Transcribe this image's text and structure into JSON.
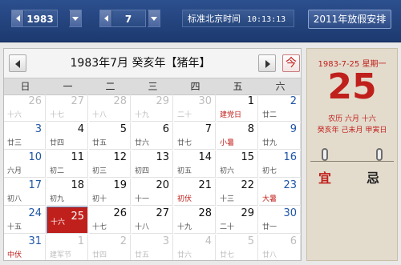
{
  "toolbar": {
    "year": "1983",
    "month": "7",
    "clock_label": "标准北京时间",
    "clock_time": "10:13:13",
    "holiday_button": "2011年放假安排"
  },
  "calendar": {
    "title": "1983年7月  癸亥年【猪年】",
    "today_label": "今",
    "weekdays": [
      "日",
      "一",
      "二",
      "三",
      "四",
      "五",
      "六"
    ],
    "weeks": [
      [
        {
          "day": "26",
          "lunar": "十六",
          "other": true
        },
        {
          "day": "27",
          "lunar": "十七",
          "other": true
        },
        {
          "day": "28",
          "lunar": "十八",
          "other": true
        },
        {
          "day": "29",
          "lunar": "十九",
          "other": true
        },
        {
          "day": "30",
          "lunar": "二十",
          "other": true
        },
        {
          "day": "1",
          "lunar": "建党日",
          "red": true
        },
        {
          "day": "2",
          "lunar": "廿二"
        }
      ],
      [
        {
          "day": "3",
          "lunar": "廿三"
        },
        {
          "day": "4",
          "lunar": "廿四"
        },
        {
          "day": "5",
          "lunar": "廿五"
        },
        {
          "day": "6",
          "lunar": "廿六"
        },
        {
          "day": "7",
          "lunar": "廿七"
        },
        {
          "day": "8",
          "lunar": "小暑",
          "red": true
        },
        {
          "day": "9",
          "lunar": "廿九"
        }
      ],
      [
        {
          "day": "10",
          "lunar": "六月"
        },
        {
          "day": "11",
          "lunar": "初二"
        },
        {
          "day": "12",
          "lunar": "初三"
        },
        {
          "day": "13",
          "lunar": "初四"
        },
        {
          "day": "14",
          "lunar": "初五"
        },
        {
          "day": "15",
          "lunar": "初六"
        },
        {
          "day": "16",
          "lunar": "初七"
        }
      ],
      [
        {
          "day": "17",
          "lunar": "初八"
        },
        {
          "day": "18",
          "lunar": "初九"
        },
        {
          "day": "19",
          "lunar": "初十"
        },
        {
          "day": "20",
          "lunar": "十一"
        },
        {
          "day": "21",
          "lunar": "初伏",
          "red": true
        },
        {
          "day": "22",
          "lunar": "十三"
        },
        {
          "day": "23",
          "lunar": "大暑",
          "red": true
        }
      ],
      [
        {
          "day": "24",
          "lunar": "十五"
        },
        {
          "day": "25",
          "lunar": "十六",
          "selected": true
        },
        {
          "day": "26",
          "lunar": "十七"
        },
        {
          "day": "27",
          "lunar": "十八"
        },
        {
          "day": "28",
          "lunar": "十九"
        },
        {
          "day": "29",
          "lunar": "二十"
        },
        {
          "day": "30",
          "lunar": "廿一"
        }
      ],
      [
        {
          "day": "31",
          "lunar": "中伏",
          "red": true
        },
        {
          "day": "1",
          "lunar": "建军节",
          "other": true
        },
        {
          "day": "2",
          "lunar": "廿四",
          "other": true
        },
        {
          "day": "3",
          "lunar": "廿五",
          "other": true
        },
        {
          "day": "4",
          "lunar": "廿六",
          "other": true
        },
        {
          "day": "5",
          "lunar": "廿七",
          "other": true
        },
        {
          "day": "6",
          "lunar": "廿八",
          "other": true
        }
      ]
    ]
  },
  "detail": {
    "date_line": "1983-7-25 星期一",
    "big_day": "25",
    "lunar_line1": "农历 六月 十六",
    "lunar_line2": "癸亥年 己未月 甲寅日",
    "good_label": "宜",
    "bad_label": "忌"
  },
  "colors": {
    "accent_red": "#c0201c",
    "toolbar_blue": "#1d3a70",
    "weekend_blue": "#1f55a6"
  }
}
